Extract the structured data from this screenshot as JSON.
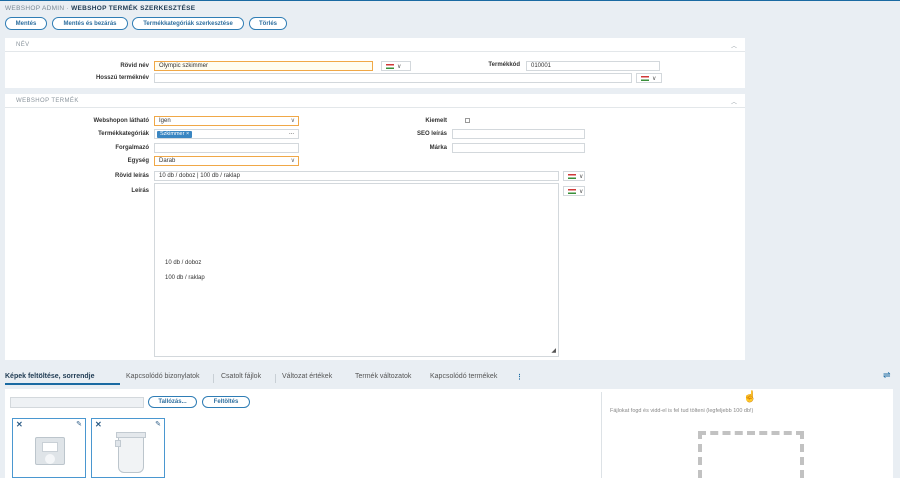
{
  "breadcrumb": {
    "root": "WEBSHOP ADMIN",
    "sep": "·",
    "current": "WEBSHOP TERMÉK SZERKESZTÉSE"
  },
  "toolbar": {
    "save": "Mentés",
    "save_close": "Mentés és bezárás",
    "categories": "Termékkategóriák szerkesztése",
    "delete": "Törlés"
  },
  "name_section": {
    "title": "NÉV",
    "short_name_label": "Rövid név",
    "short_name_value": "Olympic szkimmer",
    "long_name_label": "Hosszú terméknév",
    "long_name_value": "",
    "product_code_label": "Termékkód",
    "product_code_value": "010001"
  },
  "webshop_section": {
    "title": "WEBSHOP TERMÉK",
    "visible_label": "Webshopon látható",
    "visible_value": "Igen",
    "categories_label": "Termékkategóriák",
    "category_tag": "Szkimmer ×",
    "categories_more": "...",
    "distributor_label": "Forgalmazó",
    "unit_label": "Egység",
    "unit_value": "Darab",
    "short_desc_label": "Rövid leírás",
    "short_desc_value": "10 db / doboz | 100 db / raklap",
    "desc_label": "Leírás",
    "desc_line1": "10 db / doboz",
    "desc_line2": "100 db / raklap",
    "featured_label": "Kiemelt",
    "seo_label": "SEO leírás",
    "brand_label": "Márka"
  },
  "tabs": [
    "Képek feltöltése, sorrendje",
    "Kapcsolódó bizonylatok",
    "Csatolt fájlok",
    "Változat értékek",
    "Termék változatok",
    "Kapcsolódó termékek"
  ],
  "upload": {
    "browse": "Tallózás...",
    "upload": "Feltöltés",
    "drop_hint": "Fájlokat fogd és vidd-el is fel tud tölteni (legfeljebb 100 db!)"
  },
  "icons": {
    "collapse": "chevron-up-icon",
    "flag": "hungarian-flag-icon",
    "more": "vertical-dots-icon",
    "swap": "swap-arrows-icon"
  },
  "colors": {
    "accent": "#1a6aa2",
    "focus": "#f0a847",
    "tag": "#3a86c2"
  }
}
